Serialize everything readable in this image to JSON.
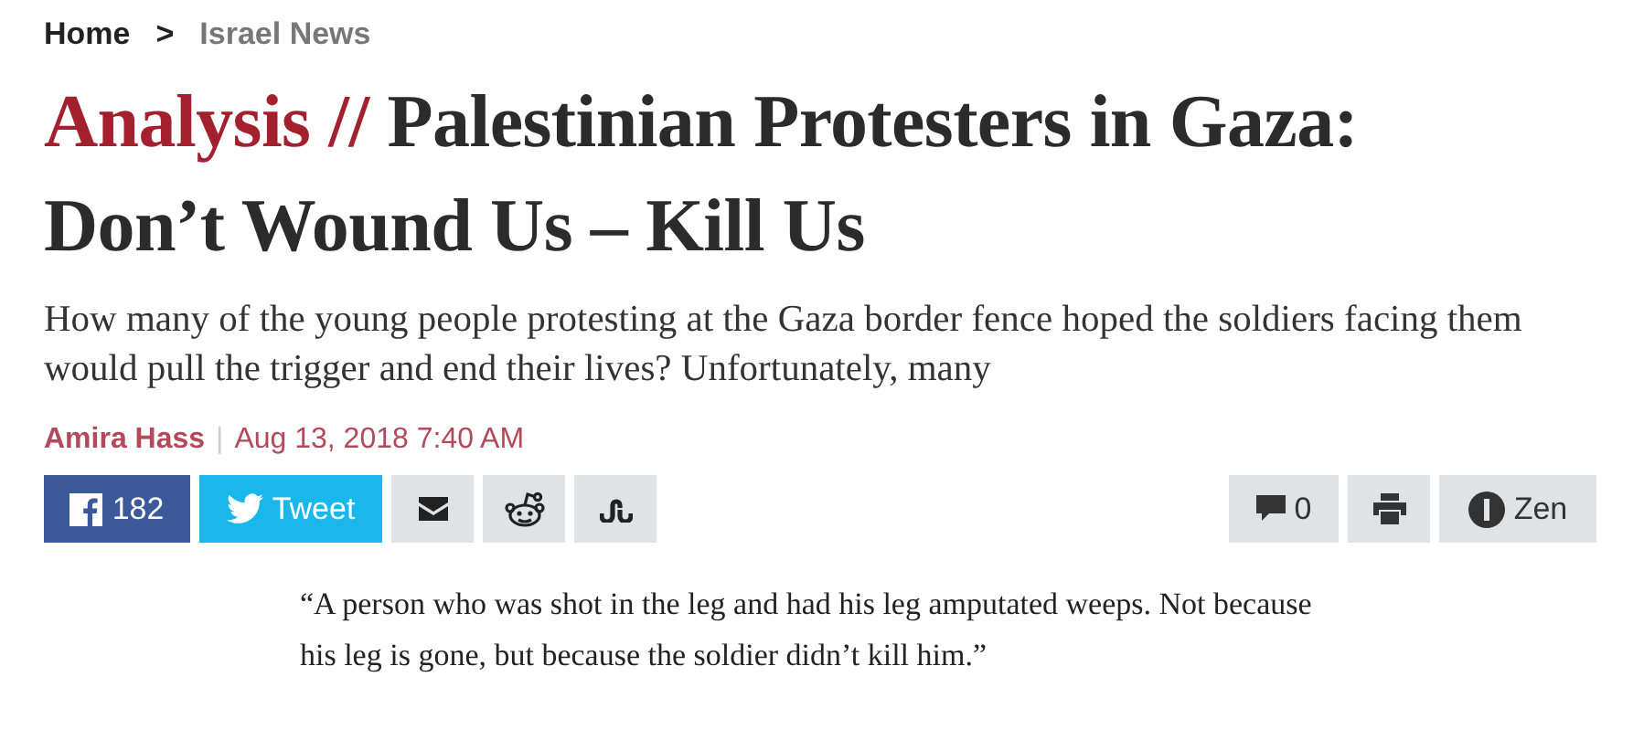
{
  "breadcrumb": {
    "items": [
      {
        "label": "Home",
        "current": false
      },
      {
        "label": "Israel News",
        "current": true
      }
    ],
    "separator": ">"
  },
  "headline": {
    "label": "Analysis //",
    "title": "Palestinian Protesters in Gaza: Don’t Wound Us – Kill Us"
  },
  "subtitle": "How many of the young people protesting at the Gaza border fence hoped the soldiers facing them would pull the trigger and end their lives? Unfortunately, many",
  "byline": {
    "author": "Amira Hass",
    "separator": "|",
    "date": "Aug 13, 2018 7:40 AM"
  },
  "share_buttons": [
    {
      "kind": "facebook",
      "text": "182"
    },
    {
      "kind": "twitter",
      "text": "Tweet"
    },
    {
      "kind": "email"
    },
    {
      "kind": "reddit"
    },
    {
      "kind": "stumbleupon"
    }
  ],
  "tool_buttons": [
    {
      "kind": "comments",
      "text": "0"
    },
    {
      "kind": "print"
    },
    {
      "kind": "zen",
      "text": "Zen"
    }
  ],
  "quote": "“A person who was shot in the leg and had his leg amputated weeps. Not because his leg is gone, but because the soldier didn’t kill him.”"
}
